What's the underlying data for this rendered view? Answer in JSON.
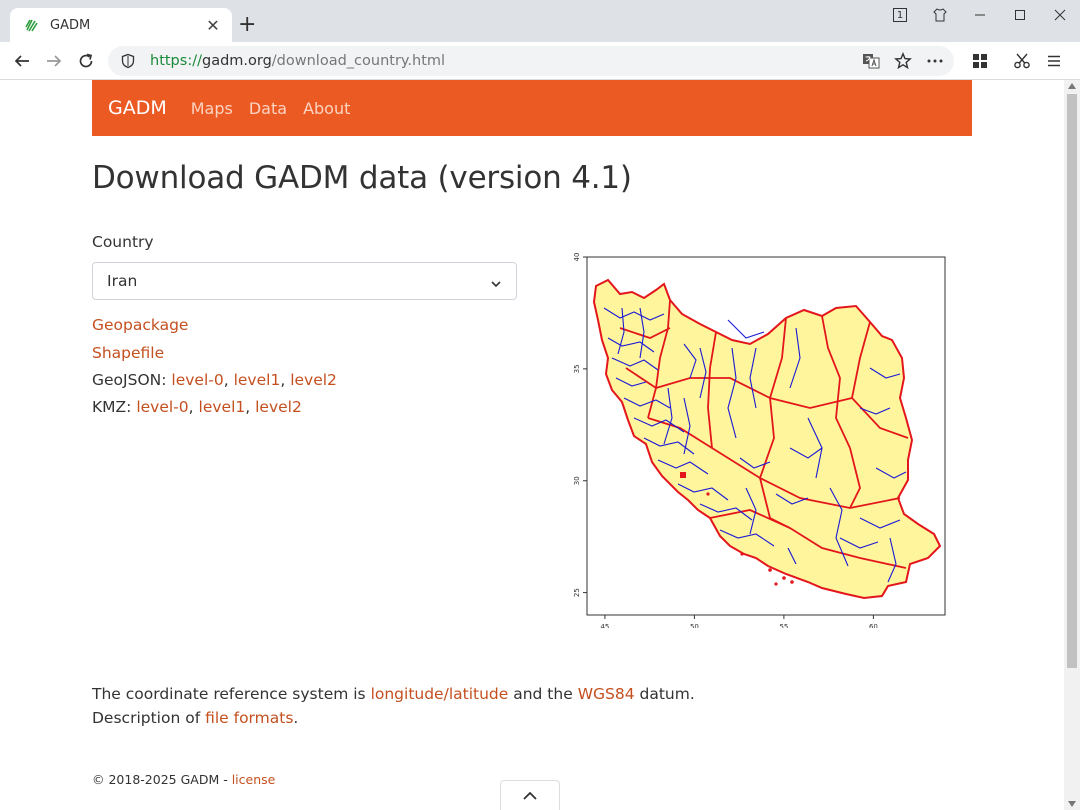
{
  "browser": {
    "tab_title": "GADM",
    "tab_count": "1",
    "url_scheme": "https://",
    "url_host": "gadm.org",
    "url_path": "/download_country.html"
  },
  "nav": {
    "brand": "GADM",
    "links": [
      "Maps",
      "Data",
      "About"
    ],
    "color": "#ec5a24"
  },
  "page": {
    "title": "Download GADM data (version 4.1)",
    "country_label": "Country",
    "country_selected": "Iran",
    "geopackage": "Geopackage",
    "shapefile": "Shapefile",
    "geojson_label": "GeoJSON:",
    "kmz_label": "KMZ:",
    "level0": "level-0",
    "level1": "level1",
    "level2": "level2",
    "sep": ","
  },
  "map": {
    "x_ticks": [
      "45",
      "50",
      "55",
      "60"
    ],
    "y_ticks": [
      "40",
      "35",
      "30",
      "25"
    ],
    "x_range": [
      44,
      64
    ],
    "y_range": [
      24,
      40
    ],
    "fill": "#fff59d",
    "level1_color": "#ee1111",
    "level2_color": "#1a1ad6"
  },
  "crs": {
    "prefix": "The coordinate reference system is ",
    "lonlat": "longitude/latitude",
    "mid": " and the ",
    "wgs84": "WGS84",
    "suffix": " datum.",
    "desc_prefix": "Description of ",
    "file_formats": "file formats",
    "desc_suffix": "."
  },
  "footer": {
    "text": "© 2018-2025 GADM - ",
    "license": "license"
  }
}
